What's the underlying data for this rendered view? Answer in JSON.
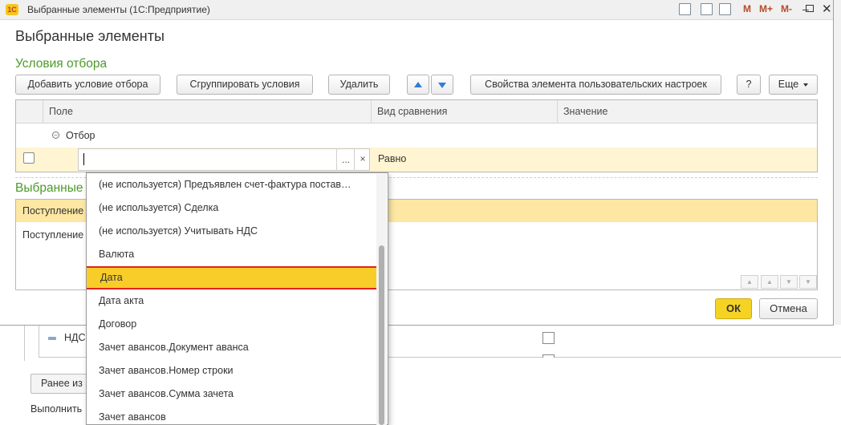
{
  "window": {
    "title": "Выбранные элементы  (1С:Предприятие)",
    "logo": "1С",
    "m1": "M",
    "m2": "M+",
    "m3": "M-"
  },
  "form": {
    "title": "Выбранные элементы"
  },
  "filter_section": {
    "title": "Условия отбора",
    "buttons": {
      "add": "Добавить условие отбора",
      "group": "Сгруппировать условия",
      "delete": "Удалить",
      "properties": "Свойства элемента пользовательских настроек",
      "help": "?",
      "more": "Еще"
    },
    "columns": {
      "field": "Поле",
      "comparison": "Вид сравнения",
      "value": "Значение"
    },
    "group_label": "Отбор",
    "edit_row": {
      "dots": "...",
      "clear": "×",
      "comparison": "Равно"
    }
  },
  "selected_section": {
    "title": "Выбранные элементы",
    "rows": [
      "Поступление",
      "Поступление"
    ]
  },
  "footer": {
    "ok": "ОК",
    "cancel": "Отмена"
  },
  "background": {
    "ndc_label": "НДС",
    "prev_button": "Ранее из",
    "execute_label": "Выполнить"
  },
  "dropdown": {
    "items": [
      "(не используется) Предъявлен счет-фактура постав…",
      "(не используется) Сделка",
      "(не используется) Учитывать НДС",
      "Валюта",
      "Дата",
      "Дата акта",
      "Договор",
      "Зачет авансов.Документ аванса",
      "Зачет авансов.Номер строки",
      "Зачет авансов.Сумма зачета",
      "Зачет авансов"
    ],
    "selected": "Дата"
  },
  "colors": {
    "accent_green": "#4c9a2a",
    "selection": "#f8cd29",
    "highlight_border": "#e0241b",
    "row_yellow": "#fde7a2"
  }
}
